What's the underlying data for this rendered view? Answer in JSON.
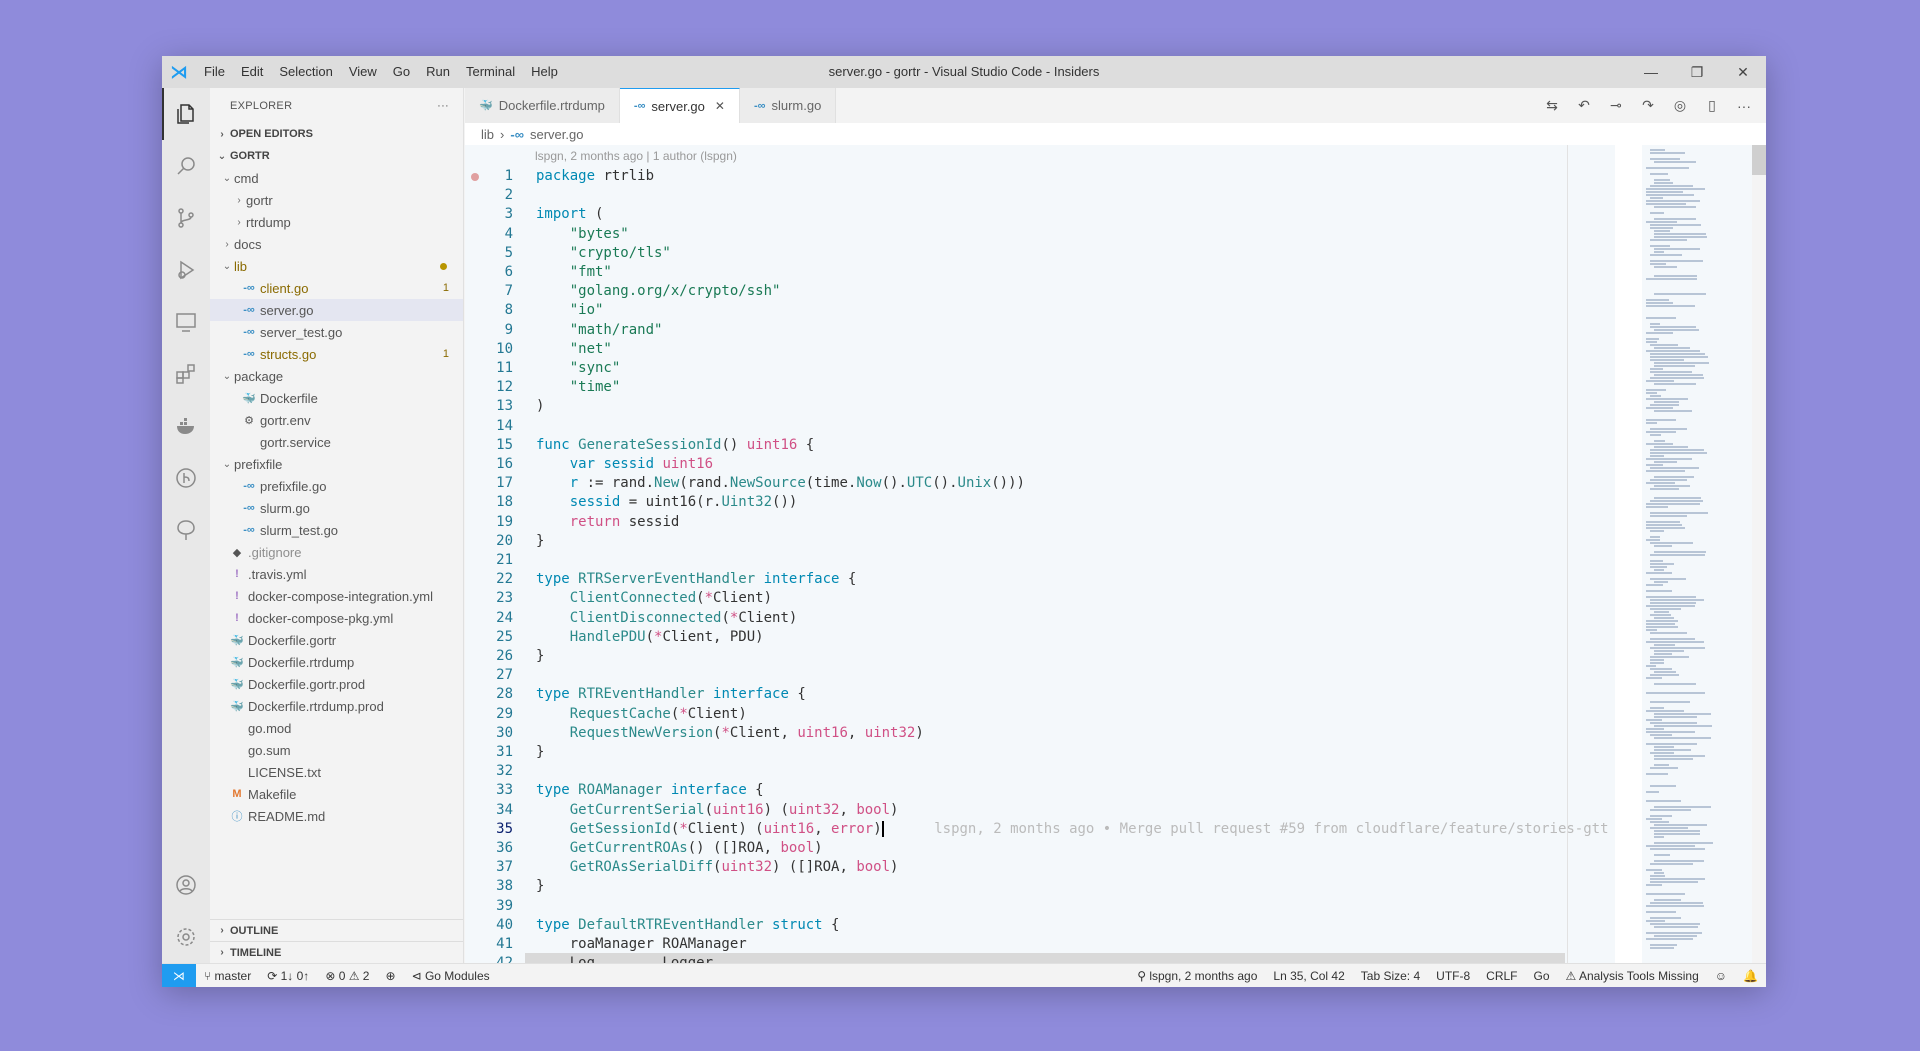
{
  "app": {
    "title": "server.go - gortr - Visual Studio Code - Insiders",
    "menu": [
      "File",
      "Edit",
      "Selection",
      "View",
      "Go",
      "Run",
      "Terminal",
      "Help"
    ]
  },
  "window_controls": {
    "minimize": "—",
    "maximize": "❐",
    "close": "✕"
  },
  "sidebar": {
    "header": "EXPLORER",
    "more": "···",
    "open_editors": "OPEN EDITORS",
    "root": "GORTR",
    "tree": [
      {
        "label": "cmd",
        "kind": "folder-open",
        "depth": 1
      },
      {
        "label": "gortr",
        "kind": "folder",
        "depth": 2
      },
      {
        "label": "rtrdump",
        "kind": "folder",
        "depth": 2
      },
      {
        "label": "docs",
        "kind": "folder",
        "depth": 1
      },
      {
        "label": "lib",
        "kind": "folder-open",
        "depth": 1,
        "modified": true
      },
      {
        "label": "client.go",
        "kind": "go",
        "depth": 2,
        "badge": "1",
        "modified": true
      },
      {
        "label": "server.go",
        "kind": "go",
        "depth": 2,
        "selected": true
      },
      {
        "label": "server_test.go",
        "kind": "go",
        "depth": 2
      },
      {
        "label": "structs.go",
        "kind": "go",
        "depth": 2,
        "badge": "1",
        "modified": true
      },
      {
        "label": "package",
        "kind": "folder-open",
        "depth": 1
      },
      {
        "label": "Dockerfile",
        "kind": "docker",
        "depth": 2
      },
      {
        "label": "gortr.env",
        "kind": "gear",
        "depth": 2
      },
      {
        "label": "gortr.service",
        "kind": "file",
        "depth": 2
      },
      {
        "label": "prefixfile",
        "kind": "folder-open",
        "depth": 1
      },
      {
        "label": "prefixfile.go",
        "kind": "go",
        "depth": 2
      },
      {
        "label": "slurm.go",
        "kind": "go",
        "depth": 2
      },
      {
        "label": "slurm_test.go",
        "kind": "go",
        "depth": 2
      },
      {
        "label": ".gitignore",
        "kind": "git",
        "depth": 1,
        "ignored": true
      },
      {
        "label": ".travis.yml",
        "kind": "yml",
        "depth": 1
      },
      {
        "label": "docker-compose-integration.yml",
        "kind": "yml",
        "depth": 1
      },
      {
        "label": "docker-compose-pkg.yml",
        "kind": "yml",
        "depth": 1
      },
      {
        "label": "Dockerfile.gortr",
        "kind": "docker",
        "depth": 1
      },
      {
        "label": "Dockerfile.rtrdump",
        "kind": "docker",
        "depth": 1
      },
      {
        "label": "Dockerfile.gortr.prod",
        "kind": "docker",
        "depth": 1
      },
      {
        "label": "Dockerfile.rtrdump.prod",
        "kind": "docker",
        "depth": 1
      },
      {
        "label": "go.mod",
        "kind": "file",
        "depth": 1
      },
      {
        "label": "go.sum",
        "kind": "file",
        "depth": 1
      },
      {
        "label": "LICENSE.txt",
        "kind": "file",
        "depth": 1
      },
      {
        "label": "Makefile",
        "kind": "make",
        "depth": 1
      },
      {
        "label": "README.md",
        "kind": "info",
        "depth": 1
      }
    ],
    "outline": "OUTLINE",
    "timeline": "TIMELINE"
  },
  "tabs": [
    {
      "label": "Dockerfile.rtrdump",
      "icon": "docker-icon"
    },
    {
      "label": "server.go",
      "icon": "go-icon",
      "active": true
    },
    {
      "label": "slurm.go",
      "icon": "go-icon"
    }
  ],
  "breadcrumb": [
    "lib",
    "server.go"
  ],
  "codelens": "lspgn, 2 months ago | 1 author (lspgn)",
  "code": [
    [
      [
        "kw",
        "package"
      ],
      [
        "t",
        " rtrlib"
      ]
    ],
    [],
    [
      [
        "kw",
        "import"
      ],
      [
        "t",
        " ("
      ]
    ],
    [
      [
        "t",
        "    "
      ],
      [
        "str",
        "\"bytes\""
      ]
    ],
    [
      [
        "t",
        "    "
      ],
      [
        "str",
        "\"crypto/tls\""
      ]
    ],
    [
      [
        "t",
        "    "
      ],
      [
        "str",
        "\"fmt\""
      ]
    ],
    [
      [
        "t",
        "    "
      ],
      [
        "str",
        "\"golang.org/x/crypto/ssh\""
      ]
    ],
    [
      [
        "t",
        "    "
      ],
      [
        "str",
        "\"io\""
      ]
    ],
    [
      [
        "t",
        "    "
      ],
      [
        "str",
        "\"math/rand\""
      ]
    ],
    [
      [
        "t",
        "    "
      ],
      [
        "str",
        "\"net\""
      ]
    ],
    [
      [
        "t",
        "    "
      ],
      [
        "str",
        "\"sync\""
      ]
    ],
    [
      [
        "t",
        "    "
      ],
      [
        "str",
        "\"time\""
      ]
    ],
    [
      [
        "t",
        ")"
      ]
    ],
    [],
    [
      [
        "kw",
        "func"
      ],
      [
        "t",
        " "
      ],
      [
        "fn",
        "GenerateSessionId"
      ],
      [
        "t",
        "() "
      ],
      [
        "ty",
        "uint16"
      ],
      [
        "t",
        " {"
      ]
    ],
    [
      [
        "t",
        "    "
      ],
      [
        "kw",
        "var"
      ],
      [
        "t",
        " "
      ],
      [
        "kw",
        "sessid"
      ],
      [
        "t",
        " "
      ],
      [
        "ty",
        "uint16"
      ]
    ],
    [
      [
        "t",
        "    "
      ],
      [
        "kw",
        "r"
      ],
      [
        "t",
        " := rand."
      ],
      [
        "fn",
        "New"
      ],
      [
        "t",
        "(rand."
      ],
      [
        "fn",
        "NewSource"
      ],
      [
        "t",
        "(time."
      ],
      [
        "fn",
        "Now"
      ],
      [
        "t",
        "()."
      ],
      [
        "fn",
        "UTC"
      ],
      [
        "t",
        "()."
      ],
      [
        "fn",
        "Unix"
      ],
      [
        "t",
        "()))"
      ]
    ],
    [
      [
        "t",
        "    "
      ],
      [
        "kw",
        "sessid"
      ],
      [
        "t",
        " = uint16(r."
      ],
      [
        "fn",
        "Uint32"
      ],
      [
        "t",
        "())"
      ]
    ],
    [
      [
        "t",
        "    "
      ],
      [
        "ty",
        "return"
      ],
      [
        "t",
        " sessid"
      ]
    ],
    [
      [
        "t",
        "}"
      ]
    ],
    [],
    [
      [
        "kw",
        "type"
      ],
      [
        "t",
        " "
      ],
      [
        "fn",
        "RTRServerEventHandler"
      ],
      [
        "t",
        " "
      ],
      [
        "kw",
        "interface"
      ],
      [
        "t",
        " {"
      ]
    ],
    [
      [
        "t",
        "    "
      ],
      [
        "fn",
        "ClientConnected"
      ],
      [
        "t",
        "("
      ],
      [
        "ptr",
        "*"
      ],
      [
        "t",
        "Client)"
      ]
    ],
    [
      [
        "t",
        "    "
      ],
      [
        "fn",
        "ClientDisconnected"
      ],
      [
        "t",
        "("
      ],
      [
        "ptr",
        "*"
      ],
      [
        "t",
        "Client)"
      ]
    ],
    [
      [
        "t",
        "    "
      ],
      [
        "fn",
        "HandlePDU"
      ],
      [
        "t",
        "("
      ],
      [
        "ptr",
        "*"
      ],
      [
        "t",
        "Client, PDU)"
      ]
    ],
    [
      [
        "t",
        "}"
      ]
    ],
    [],
    [
      [
        "kw",
        "type"
      ],
      [
        "t",
        " "
      ],
      [
        "fn",
        "RTREventHandler"
      ],
      [
        "t",
        " "
      ],
      [
        "kw",
        "interface"
      ],
      [
        "t",
        " {"
      ]
    ],
    [
      [
        "t",
        "    "
      ],
      [
        "fn",
        "RequestCache"
      ],
      [
        "t",
        "("
      ],
      [
        "ptr",
        "*"
      ],
      [
        "t",
        "Client)"
      ]
    ],
    [
      [
        "t",
        "    "
      ],
      [
        "fn",
        "RequestNewVersion"
      ],
      [
        "t",
        "("
      ],
      [
        "ptr",
        "*"
      ],
      [
        "t",
        "Client, "
      ],
      [
        "ty",
        "uint16"
      ],
      [
        "t",
        ", "
      ],
      [
        "ty",
        "uint32"
      ],
      [
        "t",
        ")"
      ]
    ],
    [
      [
        "t",
        "}"
      ]
    ],
    [],
    [
      [
        "kw",
        "type"
      ],
      [
        "t",
        " "
      ],
      [
        "fn",
        "ROAManager"
      ],
      [
        "t",
        " "
      ],
      [
        "kw",
        "interface"
      ],
      [
        "t",
        " {"
      ]
    ],
    [
      [
        "t",
        "    "
      ],
      [
        "fn",
        "GetCurrentSerial"
      ],
      [
        "t",
        "("
      ],
      [
        "ty",
        "uint16"
      ],
      [
        "t",
        ") ("
      ],
      [
        "ty",
        "uint32"
      ],
      [
        "t",
        ", "
      ],
      [
        "ty",
        "bool"
      ],
      [
        "t",
        ")"
      ]
    ],
    [
      [
        "t",
        "    "
      ],
      [
        "fn",
        "GetSessionId"
      ],
      [
        "t",
        "("
      ],
      [
        "ptr",
        "*"
      ],
      [
        "t",
        "Client) ("
      ],
      [
        "ty",
        "uint16"
      ],
      [
        "t",
        ", "
      ],
      [
        "ty",
        "error"
      ],
      [
        "t",
        ")"
      ],
      [
        "cursor",
        ""
      ],
      [
        "blame",
        "      lspgn, 2 months ago • Merge pull request #59 from cloudflare/feature/stories-gtt"
      ]
    ],
    [
      [
        "t",
        "    "
      ],
      [
        "fn",
        "GetCurrentROAs"
      ],
      [
        "t",
        "() ([]ROA, "
      ],
      [
        "ty",
        "bool"
      ],
      [
        "t",
        ")"
      ]
    ],
    [
      [
        "t",
        "    "
      ],
      [
        "fn",
        "GetROAsSerialDiff"
      ],
      [
        "t",
        "("
      ],
      [
        "ty",
        "uint32"
      ],
      [
        "t",
        ") ([]ROA, "
      ],
      [
        "ty",
        "bool"
      ],
      [
        "t",
        ")"
      ]
    ],
    [
      [
        "t",
        "}"
      ]
    ],
    [],
    [
      [
        "kw",
        "type"
      ],
      [
        "t",
        " "
      ],
      [
        "fn",
        "DefaultRTREventHandler"
      ],
      [
        "t",
        " "
      ],
      [
        "kw",
        "struct"
      ],
      [
        "t",
        " {"
      ]
    ],
    [
      [
        "t",
        "    roaManager ROAManager"
      ]
    ],
    [
      [
        "t",
        "    Log        Logger"
      ]
    ]
  ],
  "status": {
    "branch": "master",
    "sync": "1↓ 0↑",
    "problems": "⊗ 0 ⚠ 2",
    "go_modules": "Go Modules",
    "blame": "lspgn, 2 months ago",
    "position": "Ln 35, Col 42",
    "tab_size": "Tab Size: 4",
    "encoding": "UTF-8",
    "eol": "CRLF",
    "language": "Go",
    "analysis": "Analysis Tools Missing"
  }
}
